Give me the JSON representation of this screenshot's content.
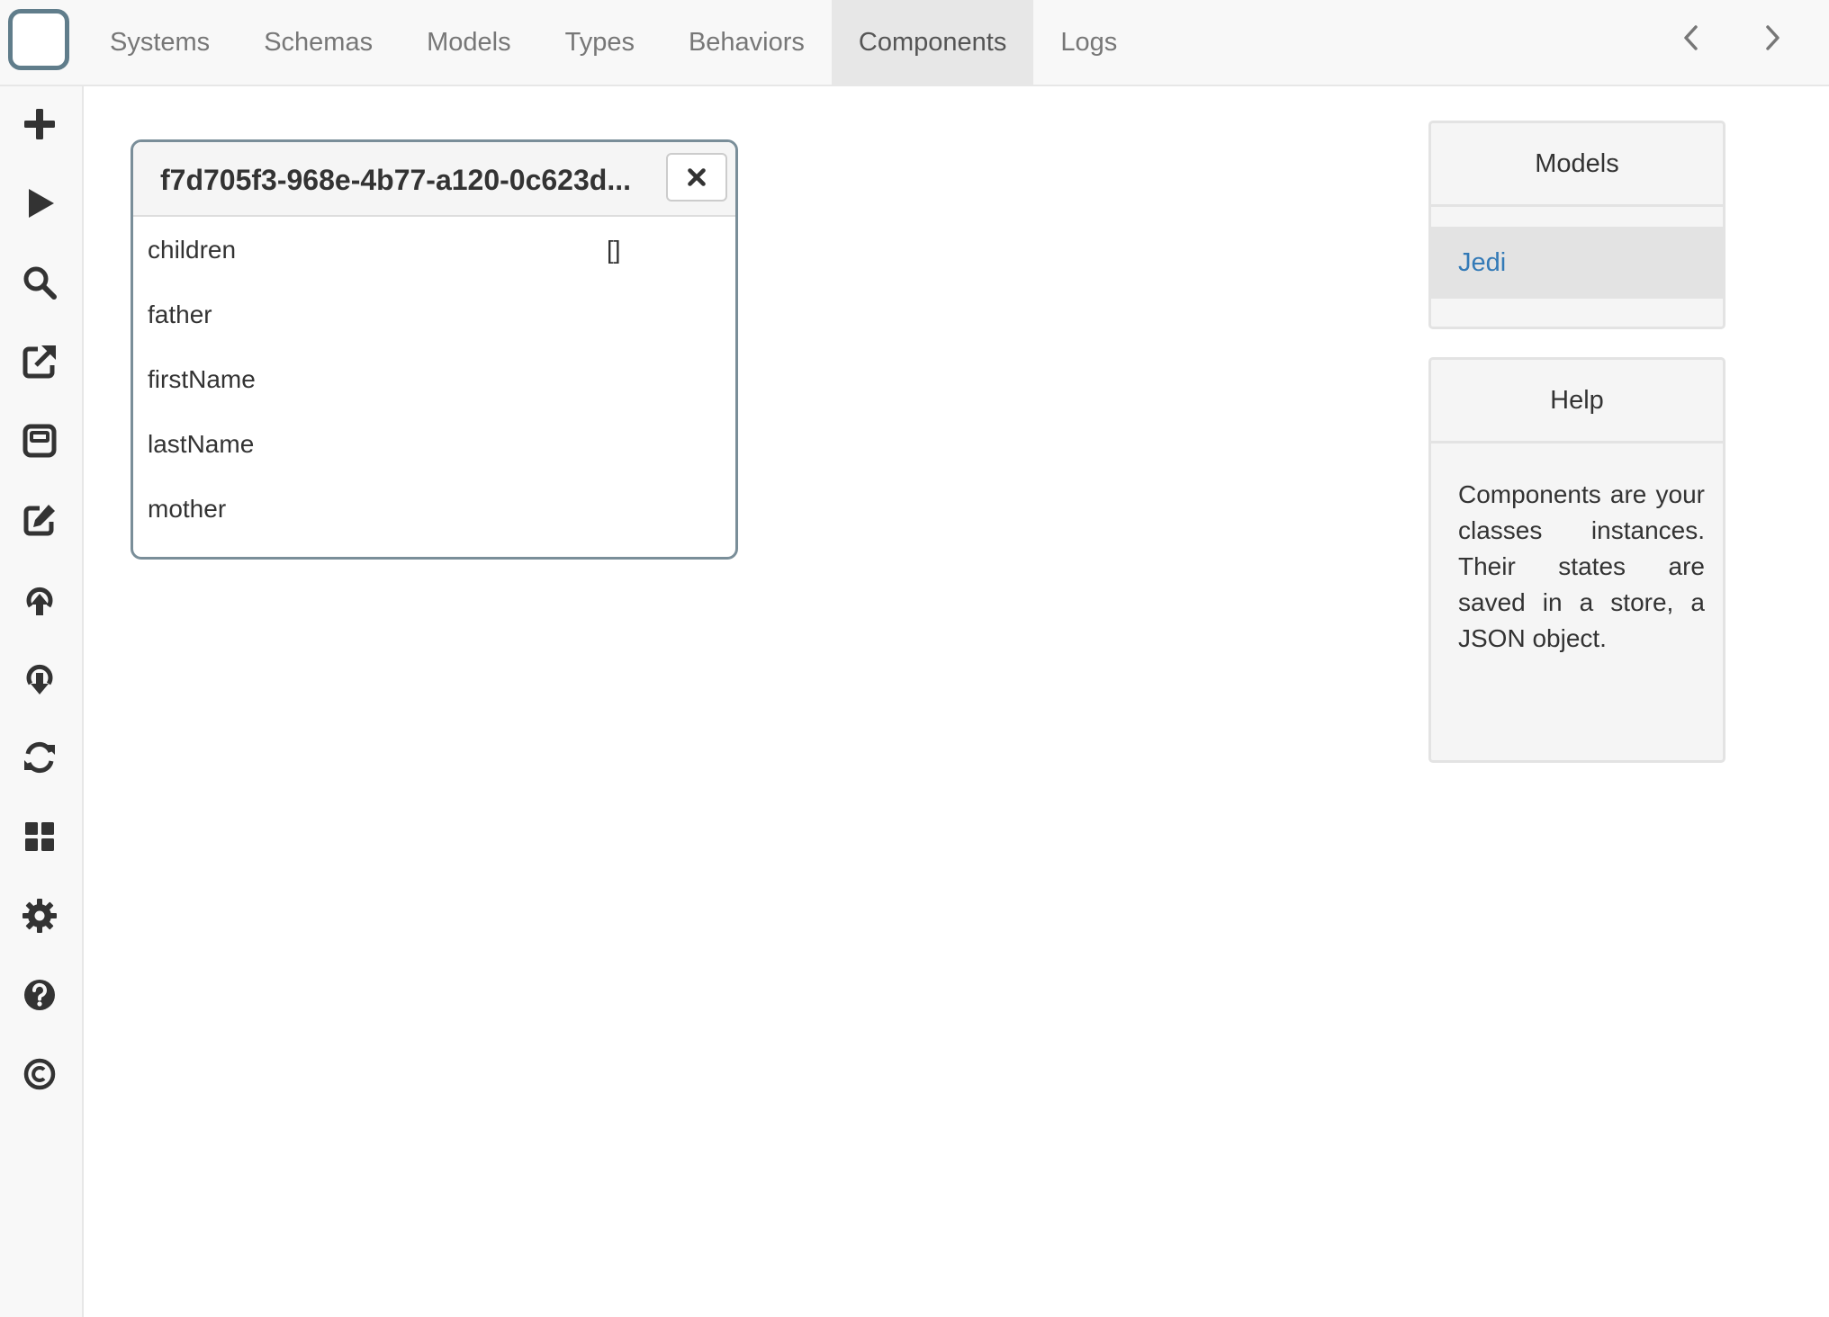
{
  "nav": {
    "logo": "app-logo-icon",
    "tabs": [
      {
        "label": "Systems"
      },
      {
        "label": "Schemas"
      },
      {
        "label": "Models"
      },
      {
        "label": "Types"
      },
      {
        "label": "Behaviors"
      },
      {
        "label": "Components",
        "active": true
      },
      {
        "label": "Logs"
      }
    ],
    "back_icon": "chevron-left-icon",
    "forward_icon": "chevron-right-icon"
  },
  "toolbar": {
    "tools": [
      {
        "icon": "plus-icon"
      },
      {
        "icon": "play-icon"
      },
      {
        "icon": "search-icon"
      },
      {
        "icon": "share-square-icon"
      },
      {
        "icon": "window-icon"
      },
      {
        "icon": "edit-icon"
      },
      {
        "icon": "upload-icon"
      },
      {
        "icon": "download-icon"
      },
      {
        "icon": "refresh-icon"
      },
      {
        "icon": "dashboard-icon"
      },
      {
        "icon": "gear-icon"
      },
      {
        "icon": "question-circle-icon"
      },
      {
        "icon": "copyright-icon"
      }
    ]
  },
  "component": {
    "title": "f7d705f3-968e-4b77-a120-0c623d...",
    "close_icon": "close-icon",
    "properties": [
      {
        "name": "children",
        "value": "[]"
      },
      {
        "name": "father",
        "value": ""
      },
      {
        "name": "firstName",
        "value": ""
      },
      {
        "name": "lastName",
        "value": ""
      },
      {
        "name": "mother",
        "value": ""
      }
    ]
  },
  "models_panel": {
    "title": "Models",
    "items": [
      {
        "label": "Jedi"
      }
    ]
  },
  "help_panel": {
    "title": "Help",
    "text": "Components are your classes instances. Their states are saved in a store, a JSON object."
  },
  "colors": {
    "accent_link": "#337ab7",
    "panel_border": "#7a8e99",
    "logo_border": "#607d8b",
    "icon": "#333333"
  }
}
